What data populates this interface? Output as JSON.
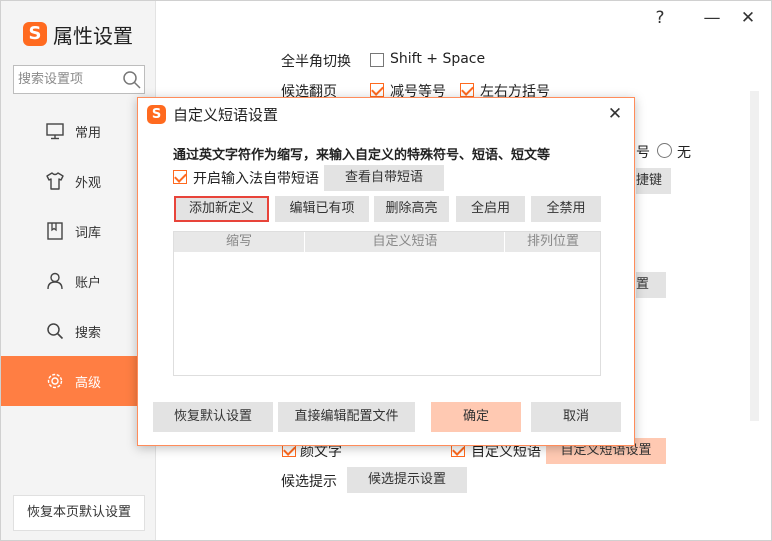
{
  "app": {
    "logo_letter": "S",
    "title": "属性设置"
  },
  "titlebar": {
    "help": "?",
    "minimize": "—",
    "close": "✕"
  },
  "search": {
    "placeholder": "搜索设置项"
  },
  "sidebar": {
    "items": [
      {
        "label": "常用",
        "icon": "monitor-icon"
      },
      {
        "label": "外观",
        "icon": "shirt-icon"
      },
      {
        "label": "词库",
        "icon": "book-icon"
      },
      {
        "label": "账户",
        "icon": "user-icon"
      },
      {
        "label": "搜索",
        "icon": "search-icon"
      },
      {
        "label": "高级",
        "icon": "gear-icon",
        "active": true
      }
    ],
    "restore_label": "恢复本页默认设置"
  },
  "background": {
    "fullhalf_label": "全半角切换",
    "shift_space_label": "Shift + Space",
    "page_turn_label": "候选翻页",
    "minus_equal_label": "减号等号",
    "brackets_label": "左右方括号",
    "partial_hao": "号",
    "none_label": "无",
    "partial_hotkey": "捷键",
    "partial_settings": "置",
    "emoticon_label": "颜文字",
    "custom_phrase_label": "自定义短语",
    "custom_phrase_settings_button": "自定义短语设置",
    "candidate_hint_label": "候选提示",
    "candidate_hint_button": "候选提示设置"
  },
  "dialog": {
    "logo_letter": "S",
    "title": "自定义短语设置",
    "close": "✕",
    "description": "通过英文字符作为缩写，来输入自定义的特殊符号、短语、短文等",
    "enable_builtin_label": "开启输入法自带短语",
    "enable_builtin_checked": true,
    "view_builtin_button": "查看自带短语",
    "toolbar": {
      "add_new": "添加新定义",
      "edit_existing": "编辑已有项",
      "delete_highlight": "删除高亮",
      "enable_all": "全启用",
      "disable_all": "全禁用"
    },
    "table": {
      "columns": [
        "缩写",
        "自定义短语",
        "排列位置"
      ],
      "rows": []
    },
    "footer": {
      "restore_default": "恢复默认设置",
      "edit_config": "直接编辑配置文件",
      "ok": "确定",
      "cancel": "取消"
    }
  },
  "colors": {
    "accent": "#ff7e43",
    "brand": "#ff6a1f",
    "ok_button": "#ffc9b2",
    "highlight_border": "#e8443a"
  }
}
